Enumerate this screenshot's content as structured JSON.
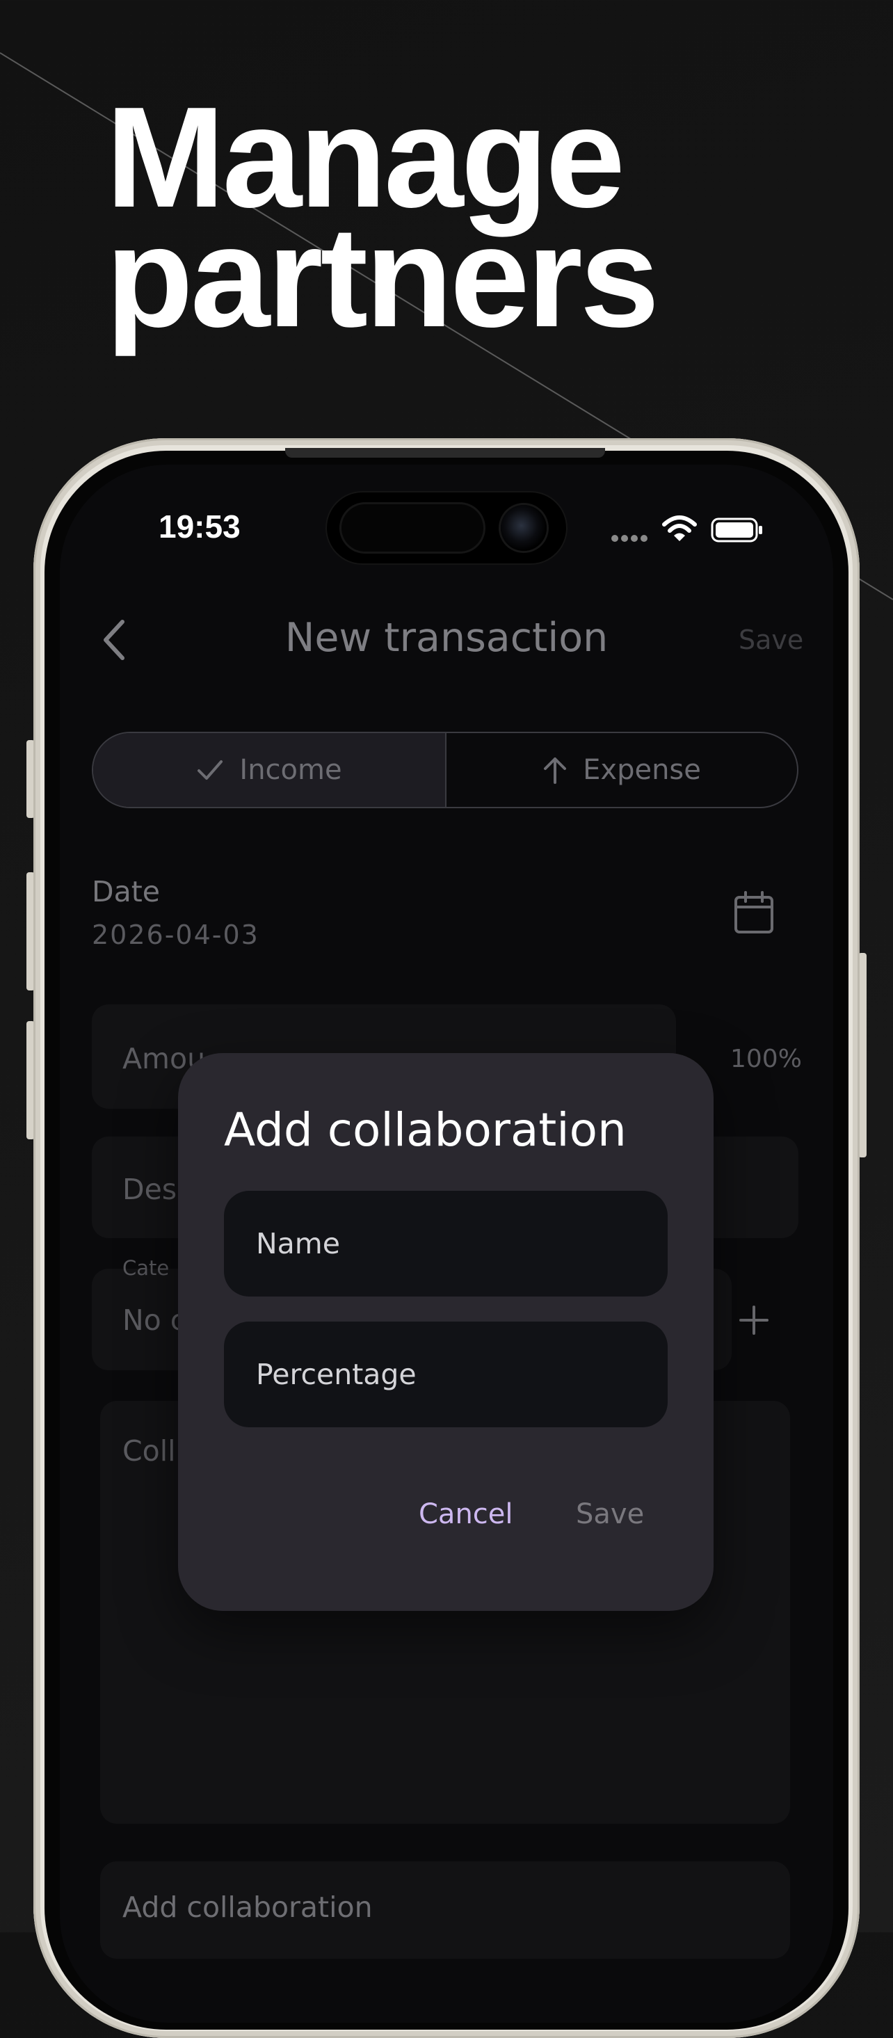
{
  "promo": {
    "line1": "Manage",
    "line2": "partners"
  },
  "status_bar": {
    "time": "19:53"
  },
  "nav": {
    "title": "New transaction",
    "save_label": "Save"
  },
  "type_toggle": {
    "income_label": "Income",
    "expense_label": "Expense",
    "selected": "Income"
  },
  "date": {
    "label": "Date",
    "value": "2026-04-03"
  },
  "amount": {
    "label_fragment": "Amou",
    "percentage": "100%"
  },
  "description": {
    "label_fragment": "Des"
  },
  "category": {
    "label_fragment": "Cate",
    "value_fragment": "No c"
  },
  "collaborations": {
    "label_fragment": "Coll",
    "add_label": "Add collaboration"
  },
  "dialog": {
    "title": "Add collaboration",
    "name_placeholder": "Name",
    "percentage_placeholder": "Percentage",
    "cancel_label": "Cancel",
    "save_label": "Save"
  },
  "colors": {
    "accent": "#cdb8f0",
    "dialog_bg": "#2a282f",
    "field_bg": "#111216"
  }
}
